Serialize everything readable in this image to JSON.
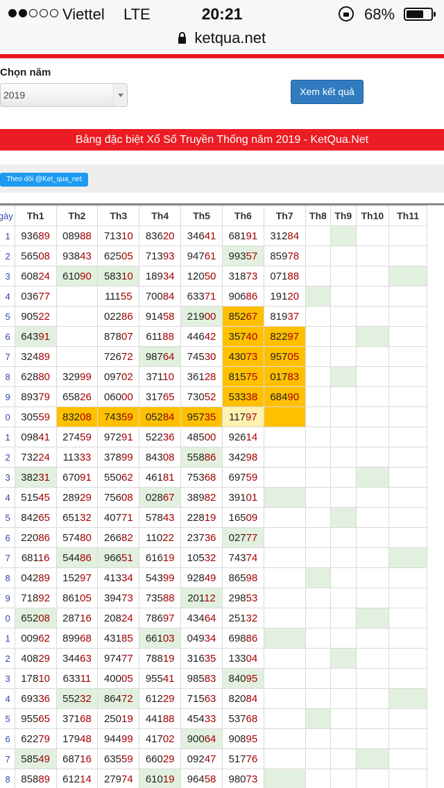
{
  "status": {
    "carrier": "Viettel",
    "network": "LTE",
    "time": "20:21",
    "battery": "68%",
    "battery_level": 0.68,
    "signal_bars": 2
  },
  "browser": {
    "url": "ketqua.net"
  },
  "form": {
    "year_label": "Chọn năm",
    "year_value": "2019",
    "view_button": "Xem kết quả"
  },
  "banner": {
    "title": "Bảng đặc biệt Xổ Số Truyền Thống năm 2019 - KetQua.Net"
  },
  "social": {
    "follow_label": "Theo dõi @Ket_qua_net"
  },
  "table": {
    "headers": [
      "ngày",
      "Th1",
      "Th2",
      "Th3",
      "Th4",
      "Th5",
      "Th6",
      "Th7",
      "Th8",
      "Th9",
      "Th10",
      "Th11"
    ],
    "rows": [
      {
        "day": "1",
        "cells": [
          "93689",
          "08988",
          "71310",
          "83620",
          "34641",
          "68191",
          "31284",
          "",
          "",
          "",
          ""
        ]
      },
      {
        "day": "2",
        "cells": [
          "56508",
          "93843",
          "62505",
          "71393",
          "94761",
          "99357",
          "85978",
          "",
          "",
          "",
          ""
        ]
      },
      {
        "day": "3",
        "cells": [
          "60824",
          "61090",
          "58310",
          "18934",
          "12050",
          "31873",
          "07188",
          "",
          "",
          "",
          ""
        ]
      },
      {
        "day": "4",
        "cells": [
          "03677",
          "",
          "11155",
          "70084",
          "63371",
          "90686",
          "19120",
          "",
          "",
          "",
          ""
        ]
      },
      {
        "day": "5",
        "cells": [
          "90522",
          "",
          "02286",
          "91458",
          "21900",
          "85267",
          "81937",
          "",
          "",
          "",
          ""
        ]
      },
      {
        "day": "6",
        "cells": [
          "64391",
          "",
          "87807",
          "61188",
          "44642",
          "35740",
          "82297",
          "",
          "",
          "",
          ""
        ]
      },
      {
        "day": "7",
        "cells": [
          "32489",
          "",
          "72672",
          "98764",
          "74530",
          "43073",
          "95705",
          "",
          "",
          "",
          ""
        ]
      },
      {
        "day": "8",
        "cells": [
          "62880",
          "32999",
          "09702",
          "37110",
          "36128",
          "81575",
          "01783",
          "",
          "",
          "",
          ""
        ]
      },
      {
        "day": "9",
        "cells": [
          "89379",
          "65826",
          "06000",
          "31765",
          "73052",
          "53338",
          "68490",
          "",
          "",
          "",
          ""
        ]
      },
      {
        "day": "0",
        "cells": [
          "30559",
          "83208",
          "74359",
          "05284",
          "95735",
          "11797",
          "",
          "",
          "",
          "",
          ""
        ]
      },
      {
        "day": "1",
        "cells": [
          "09841",
          "27459",
          "97291",
          "52236",
          "48500",
          "92614",
          "",
          "",
          "",
          "",
          ""
        ]
      },
      {
        "day": "2",
        "cells": [
          "73224",
          "11333",
          "37899",
          "84308",
          "55886",
          "34298",
          "",
          "",
          "",
          "",
          ""
        ]
      },
      {
        "day": "3",
        "cells": [
          "38231",
          "67091",
          "55062",
          "46181",
          "75368",
          "69759",
          "",
          "",
          "",
          "",
          ""
        ]
      },
      {
        "day": "4",
        "cells": [
          "51545",
          "28929",
          "75608",
          "02867",
          "38982",
          "39101",
          "",
          "",
          "",
          "",
          ""
        ]
      },
      {
        "day": "5",
        "cells": [
          "84265",
          "65132",
          "40771",
          "57843",
          "22819",
          "16509",
          "",
          "",
          "",
          "",
          ""
        ]
      },
      {
        "day": "6",
        "cells": [
          "22086",
          "57480",
          "26682",
          "11022",
          "23736",
          "02777",
          "",
          "",
          "",
          "",
          ""
        ]
      },
      {
        "day": "7",
        "cells": [
          "68116",
          "54486",
          "96651",
          "61619",
          "10532",
          "74374",
          "",
          "",
          "",
          "",
          ""
        ]
      },
      {
        "day": "8",
        "cells": [
          "04289",
          "15297",
          "41334",
          "54399",
          "92849",
          "86598",
          "",
          "",
          "",
          "",
          ""
        ]
      },
      {
        "day": "9",
        "cells": [
          "71892",
          "86105",
          "39473",
          "73588",
          "20112",
          "29853",
          "",
          "",
          "",
          "",
          ""
        ]
      },
      {
        "day": "0",
        "cells": [
          "65208",
          "28716",
          "20824",
          "78697",
          "43464",
          "25132",
          "",
          "",
          "",
          "",
          ""
        ]
      },
      {
        "day": "1",
        "cells": [
          "00962",
          "89968",
          "43185",
          "66103",
          "04934",
          "69886",
          "",
          "",
          "",
          "",
          ""
        ]
      },
      {
        "day": "2",
        "cells": [
          "40829",
          "34463",
          "97477",
          "78819",
          "31635",
          "13304",
          "",
          "",
          "",
          "",
          ""
        ]
      },
      {
        "day": "3",
        "cells": [
          "17810",
          "63311",
          "40005",
          "95541",
          "98583",
          "84095",
          "",
          "",
          "",
          "",
          ""
        ]
      },
      {
        "day": "4",
        "cells": [
          "69336",
          "55232",
          "86472",
          "61229",
          "71563",
          "82084",
          "",
          "",
          "",
          "",
          ""
        ]
      },
      {
        "day": "5",
        "cells": [
          "95565",
          "37168",
          "25019",
          "44188",
          "45433",
          "53768",
          "",
          "",
          "",
          "",
          ""
        ]
      },
      {
        "day": "6",
        "cells": [
          "62279",
          "17948",
          "94499",
          "41702",
          "90064",
          "90895",
          "",
          "",
          "",
          "",
          ""
        ]
      },
      {
        "day": "7",
        "cells": [
          "58549",
          "68716",
          "63559",
          "66029",
          "09247",
          "51776",
          "",
          "",
          "",
          "",
          ""
        ]
      },
      {
        "day": "8",
        "cells": [
          "85889",
          "61214",
          "27974",
          "61019",
          "96458",
          "98073",
          "",
          "",
          "",
          "",
          ""
        ]
      }
    ],
    "highlights": {
      "green": [
        [
          0,
          8
        ],
        [
          1,
          5
        ],
        [
          2,
          1
        ],
        [
          2,
          2
        ],
        [
          2,
          10
        ],
        [
          3,
          7
        ],
        [
          4,
          4
        ],
        [
          5,
          0
        ],
        [
          5,
          9
        ],
        [
          6,
          3
        ],
        [
          7,
          8
        ],
        [
          11,
          4
        ],
        [
          12,
          0
        ],
        [
          12,
          9
        ],
        [
          13,
          3
        ],
        [
          13,
          6
        ],
        [
          14,
          8
        ],
        [
          15,
          5
        ],
        [
          16,
          1
        ],
        [
          16,
          2
        ],
        [
          16,
          10
        ],
        [
          17,
          7
        ],
        [
          18,
          4
        ],
        [
          19,
          0
        ],
        [
          19,
          9
        ],
        [
          20,
          3
        ],
        [
          20,
          6
        ],
        [
          21,
          8
        ],
        [
          22,
          5
        ],
        [
          23,
          1
        ],
        [
          23,
          2
        ],
        [
          23,
          10
        ],
        [
          24,
          7
        ],
        [
          25,
          4
        ],
        [
          26,
          0
        ],
        [
          26,
          9
        ],
        [
          27,
          3
        ],
        [
          27,
          6
        ]
      ],
      "orange": [
        [
          4,
          5
        ],
        [
          5,
          5
        ],
        [
          5,
          6
        ],
        [
          6,
          5
        ],
        [
          6,
          6
        ],
        [
          7,
          5
        ],
        [
          7,
          6
        ],
        [
          8,
          5
        ],
        [
          8,
          6
        ],
        [
          9,
          1
        ],
        [
          9,
          2
        ],
        [
          9,
          3
        ],
        [
          9,
          4
        ],
        [
          9,
          6
        ]
      ],
      "yellow": [
        [
          9,
          5
        ]
      ]
    }
  }
}
